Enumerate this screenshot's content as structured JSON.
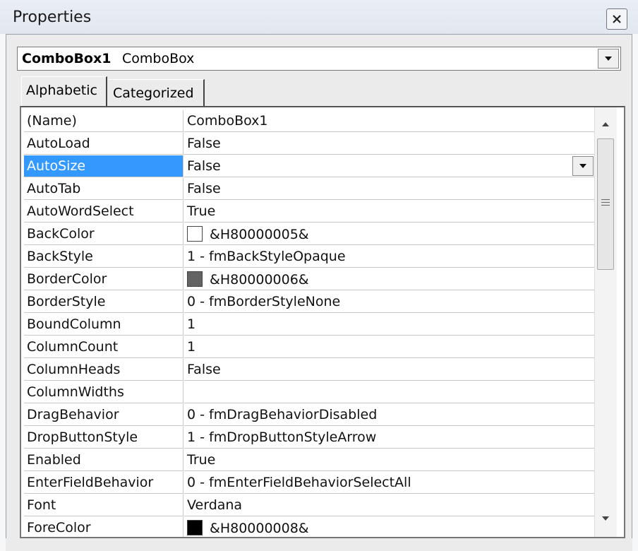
{
  "window": {
    "title": "Properties"
  },
  "object_selector": {
    "name": "ComboBox1",
    "type": "ComboBox"
  },
  "tabs": [
    {
      "label": "Alphabetic"
    },
    {
      "label": "Categorized"
    }
  ],
  "selected_property": "AutoSize",
  "properties": [
    {
      "name": "(Name)",
      "value": "ComboBox1"
    },
    {
      "name": "AutoLoad",
      "value": "False"
    },
    {
      "name": "AutoSize",
      "value": "False"
    },
    {
      "name": "AutoTab",
      "value": "False"
    },
    {
      "name": "AutoWordSelect",
      "value": "True"
    },
    {
      "name": "BackColor",
      "value": "&H80000005&",
      "swatch": "#ffffff"
    },
    {
      "name": "BackStyle",
      "value": "1 - fmBackStyleOpaque"
    },
    {
      "name": "BorderColor",
      "value": "&H80000006&",
      "swatch": "#646464"
    },
    {
      "name": "BorderStyle",
      "value": "0 - fmBorderStyleNone"
    },
    {
      "name": "BoundColumn",
      "value": "1"
    },
    {
      "name": "ColumnCount",
      "value": "1"
    },
    {
      "name": "ColumnHeads",
      "value": "False"
    },
    {
      "name": "ColumnWidths",
      "value": ""
    },
    {
      "name": "DragBehavior",
      "value": "0 - fmDragBehaviorDisabled"
    },
    {
      "name": "DropButtonStyle",
      "value": "1 - fmDropButtonStyleArrow"
    },
    {
      "name": "Enabled",
      "value": "True"
    },
    {
      "name": "EnterFieldBehavior",
      "value": "0 - fmEnterFieldBehaviorSelectAll"
    },
    {
      "name": "Font",
      "value": "Verdana"
    },
    {
      "name": "ForeColor",
      "value": "&H80000008&",
      "swatch": "#000000"
    }
  ],
  "icons": {
    "close": "close-icon",
    "dropdown": "chevron-down-icon",
    "scroll_up": "scroll-up-icon",
    "scroll_down": "scroll-down-icon"
  },
  "colors": {
    "selection": "#3399ff"
  }
}
